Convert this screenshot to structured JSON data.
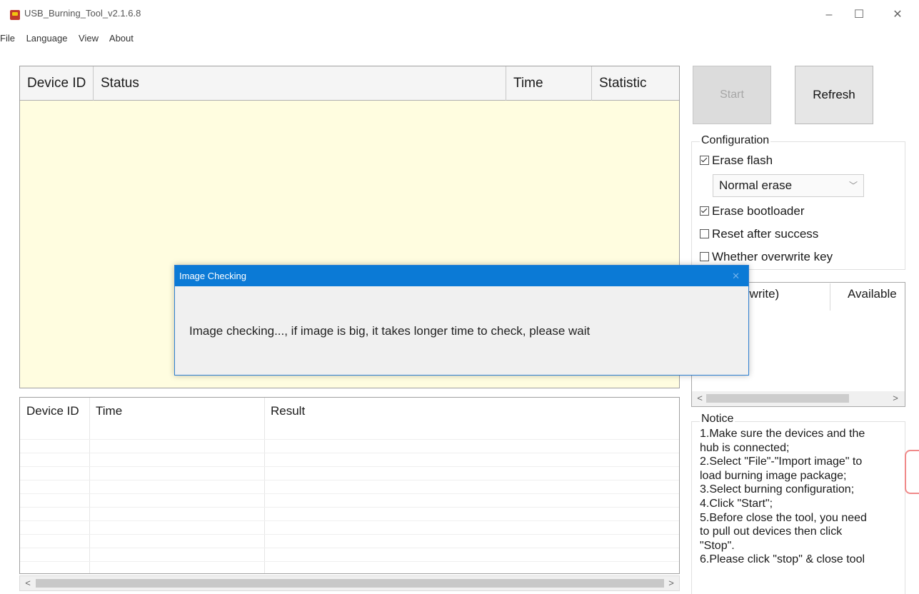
{
  "window": {
    "title": "USB_Burning_Tool_v2.1.6.8",
    "controls": {
      "minimize": "–",
      "maximize": "☐",
      "close": "✕"
    }
  },
  "menu": [
    "File",
    "Language",
    "View",
    "About"
  ],
  "device_table": {
    "columns": [
      "Device ID",
      "Status",
      "Time",
      "Statistic"
    ]
  },
  "result_table": {
    "columns": [
      "Device ID",
      "Time",
      "Result"
    ]
  },
  "buttons": {
    "start": "Start",
    "refresh": "Refresh"
  },
  "configuration": {
    "label": "Configuration",
    "erase_flash": {
      "label": "Erase flash",
      "checked": true
    },
    "erase_mode": {
      "value": "Normal erase"
    },
    "erase_bootloader": {
      "label": "Erase bootloader",
      "checked": true
    },
    "reset_after_success": {
      "label": "Reset after success",
      "checked": false
    },
    "overwrite_key": {
      "label": "Whether overwrite key",
      "checked": false
    }
  },
  "key_list": {
    "col_overwrite": "rwrite)",
    "col_available": "Available"
  },
  "notice": {
    "label": "Notice",
    "lines": [
      "1.Make sure the devices and the",
      "hub is connected;",
      "2.Select \"File\"-\"Import image\" to",
      "load burning image package;",
      "3.Select burning configuration;",
      "4.Click \"Start\";",
      "5.Before close the tool, you need",
      "to pull out devices then click",
      "\"Stop\".",
      "6.Please click \"stop\" & close tool"
    ]
  },
  "dialog": {
    "title": "Image Checking",
    "message": "Image checking..., if image is big, it takes longer time to check, please wait"
  },
  "scroll": {
    "left": "<",
    "right": ">"
  }
}
